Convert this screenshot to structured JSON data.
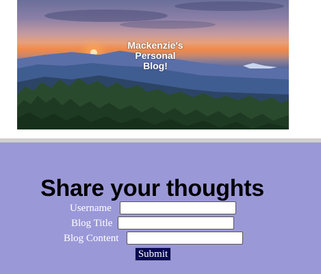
{
  "hero": {
    "title_lines": [
      "Mackenzie's",
      "Personal",
      "Blog!"
    ]
  },
  "form": {
    "heading": "Share your thoughts",
    "fields": [
      {
        "label": "Username",
        "value": "",
        "placeholder": ""
      },
      {
        "label": "Blog Title",
        "value": "",
        "placeholder": ""
      },
      {
        "label": "Blog Content",
        "value": "",
        "placeholder": ""
      }
    ],
    "submit_label": "Submit"
  },
  "colors": {
    "panel_background": "#9b98d8",
    "submit_background": "#0a0a50",
    "divider": "#cfcfcf"
  }
}
